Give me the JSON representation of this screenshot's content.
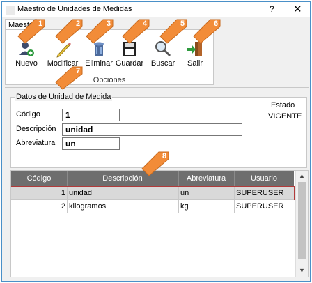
{
  "window": {
    "title": "Maestro de Unidades de Medidas",
    "help_glyph": "?",
    "close_glyph": "✕"
  },
  "ribbon": {
    "tab": "Maestro",
    "group_label": "Opciones",
    "buttons": [
      {
        "label": "Nuevo",
        "icon": "user-add-icon"
      },
      {
        "label": "Modificar",
        "icon": "pencil-icon"
      },
      {
        "label": "Eliminar",
        "icon": "trash-icon"
      },
      {
        "label": "Guardar",
        "icon": "floppy-icon"
      },
      {
        "label": "Buscar",
        "icon": "magnifier-icon"
      },
      {
        "label": "Salir",
        "icon": "exit-door-icon"
      }
    ]
  },
  "form": {
    "legend": "Datos de Unidad de Medida",
    "codigo_label": "Código",
    "codigo_value": "1",
    "descripcion_label": "Descripción",
    "descripcion_value": "unidad",
    "abreviatura_label": "Abreviatura",
    "abreviatura_value": "un",
    "estado_label": "Estado",
    "estado_value": "VIGENTE"
  },
  "grid": {
    "columns": [
      "Código",
      "Descripción",
      "Abreviatura",
      "Usuario"
    ],
    "rows": [
      {
        "codigo": "1",
        "descripcion": "unidad",
        "abreviatura": "un",
        "usuario": "SUPERUSER"
      },
      {
        "codigo": "2",
        "descripcion": "kilogramos",
        "abreviatura": "kg",
        "usuario": "SUPERUSER"
      }
    ]
  },
  "callouts": [
    "1",
    "2",
    "3",
    "4",
    "5",
    "6",
    "7",
    "8"
  ],
  "colors": {
    "callout": "#f28c38",
    "header": "#6e6e6e",
    "selection": "#d9d9d9",
    "border": "#4a90c8"
  }
}
